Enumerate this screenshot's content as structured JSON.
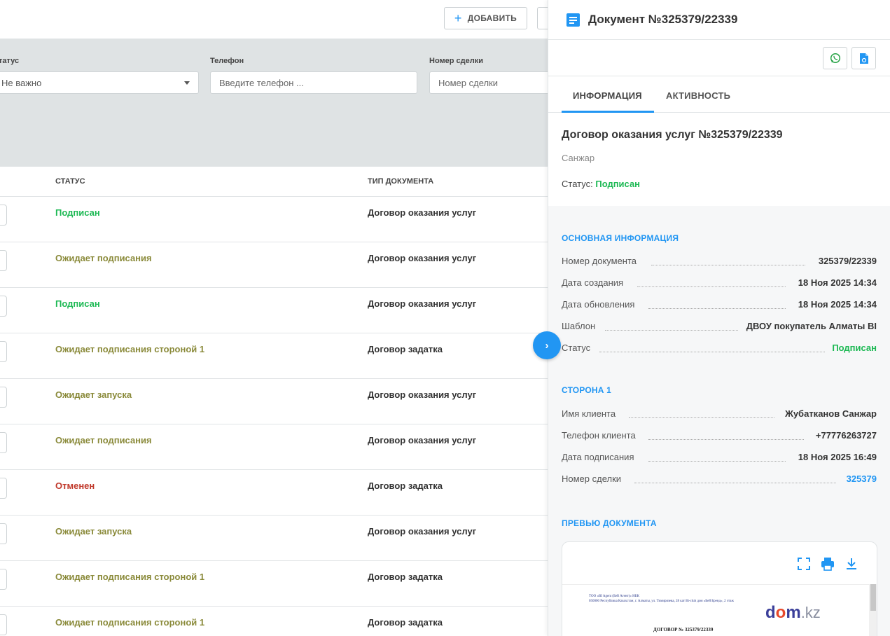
{
  "toolbar": {
    "add_label": "ДОБАВИТЬ"
  },
  "filters": {
    "status": {
      "label": "Статус",
      "value": "Не важно"
    },
    "phone": {
      "label": "Телефон",
      "placeholder": "Введите телефон ..."
    },
    "deal": {
      "label": "Номер сделки",
      "placeholder": "Номер сделки"
    }
  },
  "table": {
    "headers": {
      "status": "СТАТУС",
      "doctype": "ТИП ДОКУМЕНТА"
    },
    "rows": [
      {
        "status": "Подписан",
        "doctype": "Договор оказания услуг"
      },
      {
        "status": "Ожидает подписания",
        "doctype": "Договор оказания услуг"
      },
      {
        "status": "Подписан",
        "doctype": "Договор оказания услуг"
      },
      {
        "status": "Ожидает подписания стороной 1",
        "doctype": "Договор задатка"
      },
      {
        "status": "Ожидает запуска",
        "doctype": "Договор оказания услуг"
      },
      {
        "status": "Ожидает подписания",
        "doctype": "Договор оказания услуг"
      },
      {
        "status": "Отменен",
        "doctype": "Договор задатка"
      },
      {
        "status": "Ожидает запуска",
        "doctype": "Договор оказания услуг"
      },
      {
        "status": "Ожидает подписания стороной 1",
        "doctype": "Договор задатка"
      },
      {
        "status": "Ожидает подписания стороной 1",
        "doctype": "Договор задатка"
      }
    ]
  },
  "colors": {
    "accent": "#2196f3",
    "signed": "#1db954",
    "pending": "#8a8a3a",
    "cancelled": "#c0392b"
  },
  "panel": {
    "title": "Документ №325379/22339",
    "tabs": {
      "info": "ИНФОРМАЦИЯ",
      "activity": "АКТИВНОСТЬ"
    },
    "contract_title": "Договор оказания услуг №325379/22339",
    "author": "Санжар",
    "status_label": "Статус:",
    "status_value": "Подписан",
    "main_info": {
      "title": "ОСНОВНАЯ ИНФОРМАЦИЯ",
      "items": [
        {
          "key": "Номер документа",
          "value": "325379/22339"
        },
        {
          "key": "Дата создания",
          "value": "18 Ноя 2025 14:34"
        },
        {
          "key": "Дата обновления",
          "value": "18 Ноя 2025 14:34"
        },
        {
          "key": "Шаблон",
          "value": "ДВОУ покупатель Алматы BI"
        },
        {
          "key": "Статус",
          "value": "Подписан"
        }
      ]
    },
    "side1": {
      "title": "СТОРОНА 1",
      "items": [
        {
          "key": "Имя клиента",
          "value": "Жубатканов Санжар"
        },
        {
          "key": "Телефон клиента",
          "value": "+77776263727"
        },
        {
          "key": "Дата подписания",
          "value": "18 Ноя 2025 16:49"
        },
        {
          "key": "Номер сделки",
          "value": "325379"
        }
      ]
    },
    "preview": {
      "title": "ПРЕВЬЮ ДОКУМЕНТА",
      "doc_line1": "ТОО «BI Agent (Бей Агент)» НБК",
      "doc_line2": "050000 Республика Казахстан, г. Алматы, ул. Тимирязева, 28 кат Bi-club дом «Бей Бренд», 2 этаж",
      "logo_dom": "d",
      "logo_o": "o",
      "logo_m": "m",
      "logo_kz": ".kz",
      "doc_heading": "ДОГОВОР № 325379/22339"
    }
  }
}
